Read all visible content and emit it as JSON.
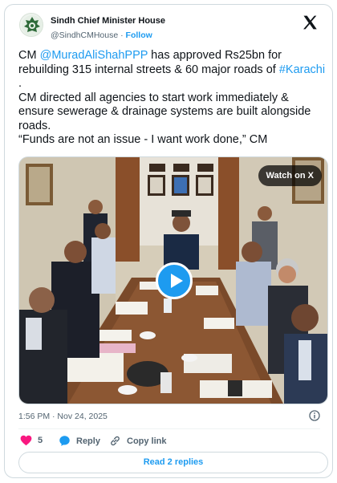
{
  "author": {
    "name": "Sindh Chief Minister House",
    "handle": "@SindhCMHouse",
    "separator": "·",
    "follow_label": "Follow",
    "avatar_icon": "sindh-govt-emblem-icon",
    "platform_icon": "x-logo-icon"
  },
  "tweet": {
    "line1_pre": "CM ",
    "mention": "@MuradAliShahPPP",
    "line1_post": " has approved Rs25bn for rebuilding 315 internal streets & 60 major roads of ",
    "hashtag": "#Karachi",
    "line1_end": " .",
    "line2": "CM directed all agencies to start work immediately & ensure sewerage & drainage systems are built alongside roads.",
    "line3": "“Funds are not an issue - I want work done,” CM"
  },
  "media": {
    "type": "video",
    "watch_label": "Watch on X",
    "play_icon": "play-icon"
  },
  "meta": {
    "timestamp": "1:56 PM · Nov 24, 2025",
    "info_icon": "info-icon"
  },
  "actions": {
    "like_count": "5",
    "reply_label": "Reply",
    "copy_link_label": "Copy link"
  },
  "read_replies_label": "Read 2 replies",
  "colors": {
    "link": "#1d9bf0",
    "like": "#f91880",
    "muted": "#536471",
    "border": "#cfd9de"
  }
}
